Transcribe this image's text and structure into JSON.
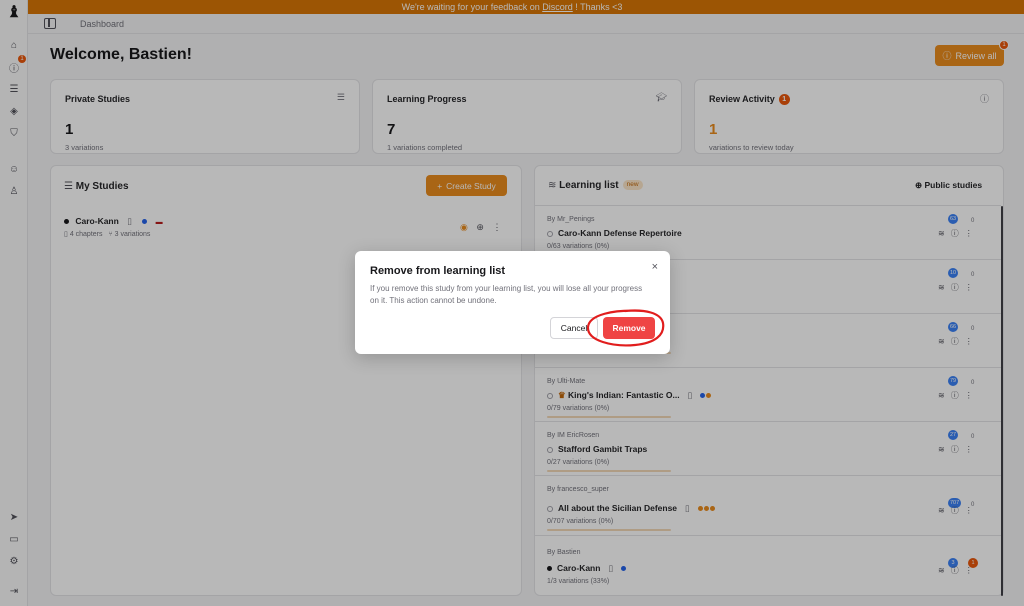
{
  "banner": {
    "prefix": "We're waiting for your feedback on ",
    "link": "Discord",
    "suffix": " ! Thanks <3"
  },
  "sidebar": {
    "logo": "♝",
    "notif_count": "1",
    "items": [
      {
        "icon": "home-icon",
        "glyph": "⌂"
      },
      {
        "icon": "info-icon",
        "glyph": "ⓘ"
      },
      {
        "icon": "database-icon",
        "glyph": "☰"
      },
      {
        "icon": "cube-icon",
        "glyph": "◈"
      },
      {
        "icon": "shield-icon",
        "glyph": "⛉"
      },
      {
        "icon": "discord-icon",
        "glyph": "☺"
      },
      {
        "icon": "user-icon",
        "glyph": "♙"
      },
      {
        "icon": "send-icon",
        "glyph": "➤"
      },
      {
        "icon": "terminal-icon",
        "glyph": "▭"
      },
      {
        "icon": "settings-icon",
        "glyph": "⚙"
      },
      {
        "icon": "logout-icon",
        "glyph": "⇥"
      }
    ]
  },
  "breadcrumb": "Dashboard",
  "welcome": "Welcome, Bastien!",
  "review_all": {
    "label": "Review all",
    "badge": "1"
  },
  "stats": {
    "private": {
      "title": "Private Studies",
      "value": "1",
      "sub": "3 variations"
    },
    "progress": {
      "title": "Learning Progress",
      "value": "7",
      "sub": "1 variations completed"
    },
    "review": {
      "title": "Review Activity",
      "badge": "1",
      "value": "1",
      "sub": "variations to review today"
    }
  },
  "my_studies": {
    "title": "My Studies",
    "create_label": "Create Study",
    "study": {
      "name": "Caro-Kann",
      "chapters": "4 chapters",
      "variations": "3 variations"
    }
  },
  "learning_list": {
    "title": "Learning list",
    "new_badge": "new",
    "public_label": "Public studies",
    "items": [
      {
        "by": "By Mr_Penings",
        "name": "Caro-Kann Defense Repertoire",
        "progress": "0/63 variations (0%)",
        "count": "63"
      },
      {
        "by": "",
        "name": "",
        "progress": "",
        "count": "10"
      },
      {
        "by": "",
        "name": "",
        "progress": "",
        "count": "66"
      },
      {
        "by": "By Ulti-Mate",
        "name": "King's Indian: Fantastic O...",
        "progress": "0/79 variations (0%)",
        "count": "79"
      },
      {
        "by": "By IM EricRosen",
        "name": "Stafford Gambit Traps",
        "progress": "0/27 variations (0%)",
        "count": "27"
      },
      {
        "by": "By francesco_super",
        "name": "All about the Sicilian Defense",
        "progress": "0/707 variations (0%)",
        "count": "707"
      },
      {
        "by": "By Bastien",
        "name": "Caro-Kann",
        "progress": "1/3 variations (33%)",
        "count": "3"
      }
    ],
    "zero": "0"
  },
  "modal": {
    "title": "Remove from learning list",
    "description": "If you remove this study from your learning list, you will lose all your progress on it. This action cannot be undone.",
    "cancel": "Cancel",
    "remove": "Remove",
    "close": "×"
  },
  "colors": {
    "accent": "#ea8c1e",
    "danger": "#ef4444",
    "annotation": "#e11d1d"
  }
}
